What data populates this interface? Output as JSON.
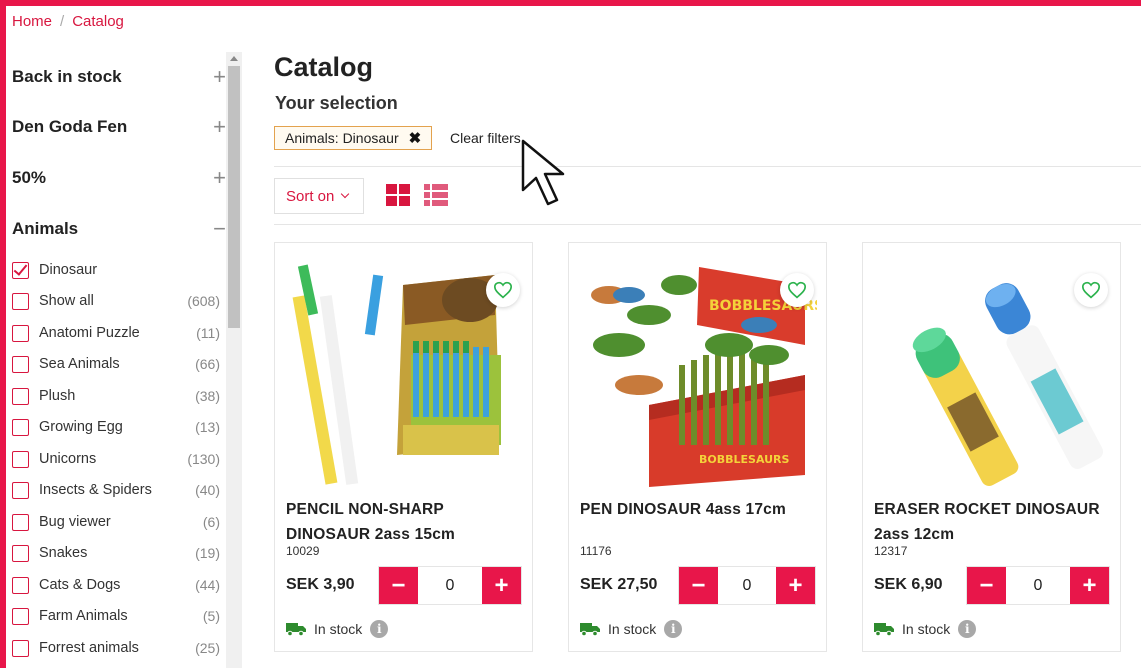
{
  "breadcrumb": {
    "home": "Home",
    "separator": "/",
    "current": "Catalog"
  },
  "sidebar": {
    "facets": [
      {
        "title": "Back in stock",
        "toggle": "+"
      },
      {
        "title": "Den Goda Fen",
        "toggle": "+"
      },
      {
        "title": "50%",
        "toggle": "+"
      },
      {
        "title": "Animals",
        "toggle": "−"
      }
    ],
    "options": [
      {
        "label": "Dinosaur",
        "count": "",
        "checked": true
      },
      {
        "label": "Show all",
        "count": "(608)",
        "checked": false
      },
      {
        "label": "Anatomi Puzzle",
        "count": "(11)",
        "checked": false
      },
      {
        "label": "Sea Animals",
        "count": "(66)",
        "checked": false
      },
      {
        "label": "Plush",
        "count": "(38)",
        "checked": false
      },
      {
        "label": "Growing Egg",
        "count": "(13)",
        "checked": false
      },
      {
        "label": "Unicorns",
        "count": "(130)",
        "checked": false
      },
      {
        "label": "Insects & Spiders",
        "count": "(40)",
        "checked": false
      },
      {
        "label": "Bug viewer",
        "count": "(6)",
        "checked": false
      },
      {
        "label": "Snakes",
        "count": "(19)",
        "checked": false
      },
      {
        "label": "Cats & Dogs",
        "count": "(44)",
        "checked": false
      },
      {
        "label": "Farm Animals",
        "count": "(5)",
        "checked": false
      },
      {
        "label": "Forrest animals",
        "count": "(25)",
        "checked": false
      }
    ]
  },
  "main": {
    "title": "Catalog",
    "selection_title": "Your selection",
    "active_filter": "Animals: Dinosaur",
    "active_filter_remove": "✖",
    "clear_filters": "Clear filters",
    "sort_label": "Sort on"
  },
  "products": [
    {
      "name": "PENCIL NON-SHARP DINOSAUR 2ass 15cm",
      "sku": "10029",
      "price": "SEK 3,90",
      "qty": "0",
      "stock": "In stock",
      "img_icon": "pencil-dinosaur-product-image"
    },
    {
      "name": "PEN DINOSAUR 4ass 17cm",
      "sku": "11176",
      "price": "SEK 27,50",
      "qty": "0",
      "stock": "In stock",
      "img_icon": "bobblesaurs-pen-display-product-image"
    },
    {
      "name": "ERASER ROCKET DINOSAUR 2ass 12cm",
      "sku": "12317",
      "price": "SEK 6,90",
      "qty": "0",
      "stock": "In stock",
      "img_icon": "eraser-rocket-product-image"
    }
  ],
  "labels": {
    "minus": "−",
    "plus": "+",
    "info": "i"
  },
  "colors": {
    "accent": "#e8164a",
    "link": "#d8163f",
    "stock_green": "#2e8b2e",
    "chip_border": "#e3a24e",
    "heart": "#2bb24c"
  }
}
